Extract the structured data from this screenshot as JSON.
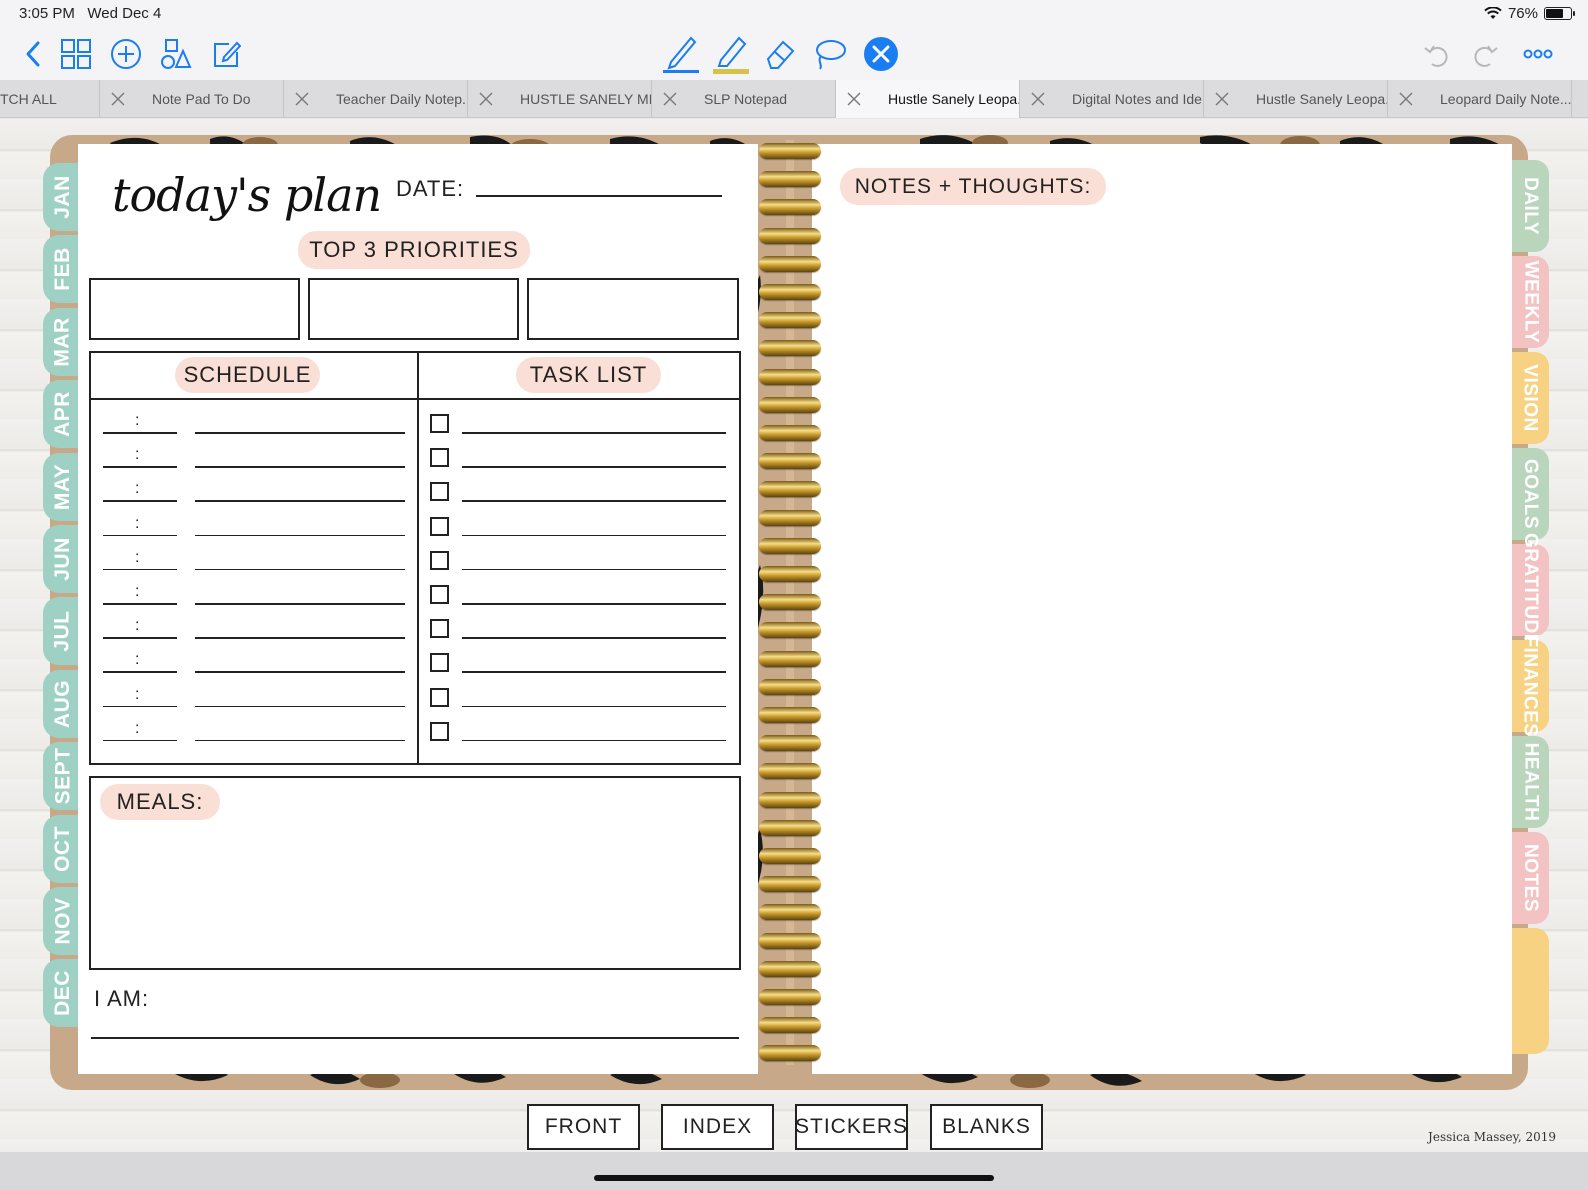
{
  "status_bar": {
    "time": "3:05 PM",
    "date": "Wed Dec 4",
    "battery": "76%",
    "battery_level": 0.76
  },
  "toolbar": {
    "left_icons": [
      "back-chevron-icon",
      "thumbnails-grid-icon",
      "add-circle-icon",
      "shapes-icon",
      "edit-compose-icon"
    ],
    "center_tools": [
      "pen-tool-icon",
      "highlighter-tool-icon",
      "eraser-tool-icon",
      "lasso-tool-icon",
      "bluetooth-pencil-icon"
    ],
    "right_icons": [
      "undo-icon",
      "redo-icon",
      "more-icon"
    ],
    "accent": "#1a7ef0"
  },
  "tabs": [
    {
      "label": "TCH ALL",
      "active": false,
      "has_close": false
    },
    {
      "label": "Note Pad To Do",
      "active": false,
      "has_close": true
    },
    {
      "label": "Teacher Daily Notep...",
      "active": false,
      "has_close": true
    },
    {
      "label": "HUSTLE SANELY MI...",
      "active": false,
      "has_close": true
    },
    {
      "label": "SLP Notepad",
      "active": false,
      "has_close": true
    },
    {
      "label": "Hustle Sanely Leopa...",
      "active": true,
      "has_close": true
    },
    {
      "label": "Digital Notes and Ide...",
      "active": false,
      "has_close": true
    },
    {
      "label": "Hustle Sanely Leopa...",
      "active": false,
      "has_close": true
    },
    {
      "label": "Leopard Daily Note...",
      "active": false,
      "has_close": true
    }
  ],
  "planner": {
    "title_script": "today's plan",
    "date_label": "DATE:",
    "priorities_label": "TOP 3 PRIORITIES",
    "schedule_label": "SCHEDULE",
    "task_list_label": "TASK LIST",
    "time_separator": ":",
    "meals_label": "MEALS:",
    "i_am_label": "I AM:",
    "notes_label": "NOTES + THOUGHTS:",
    "pill_color": "#f9dfd6",
    "month_tab_color": "#9fd0c4",
    "months": [
      "JAN",
      "FEB",
      "MAR",
      "APR",
      "MAY",
      "JUN",
      "JUL",
      "AUG",
      "SEPT",
      "OCT",
      "NOV",
      "DEC"
    ],
    "sections": [
      {
        "label": "DAILY",
        "color": "#b9d6bd"
      },
      {
        "label": "WEEKLY",
        "color": "#f3c3c3"
      },
      {
        "label": "VISION",
        "color": "#f6d282"
      },
      {
        "label": "GOALS",
        "color": "#b9d6bd"
      },
      {
        "label": "GRATITUDE",
        "color": "#f3c3c3"
      },
      {
        "label": "FINANCES",
        "color": "#f6d282"
      },
      {
        "label": "HEALTH",
        "color": "#b9d6bd"
      },
      {
        "label": "NOTES",
        "color": "#f3c3c3"
      },
      {
        "label": "",
        "color": "#f6d282"
      }
    ]
  },
  "bottom_nav": [
    "FRONT",
    "INDEX",
    "STICKERS",
    "BLANKS"
  ],
  "credit": "Jessica Massey, 2019"
}
